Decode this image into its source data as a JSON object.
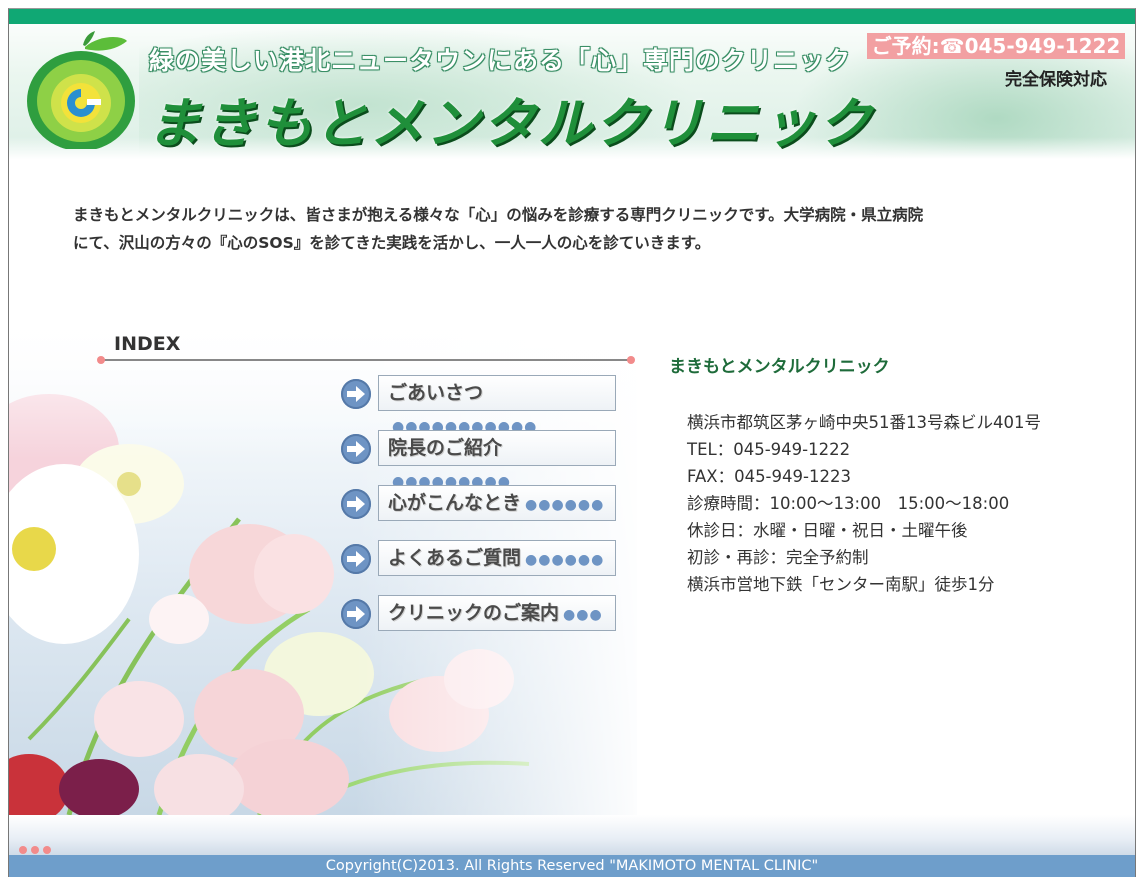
{
  "header": {
    "tagline": "緑の美しい港北ニュータウンにある「心」専門のクリニック",
    "title": "まきもとメンタルクリニック",
    "phone": "ご予約:☎045-949-1222",
    "insurance": "完全保険対応"
  },
  "intro": {
    "line1": "まきもとメンタルクリニックは、皆さまが抱える様々な「心」の悩みを診療する専門クリニックです。大学病院・県立病院",
    "line2": "にて、沢山の方々の『心のSOS』を診てきた実践を活かし、一人一人の心を診ていきます。"
  },
  "index": {
    "heading": "INDEX",
    "items": [
      {
        "label": "ごあいさつ",
        "dots": "●●●●●●●●●●●"
      },
      {
        "label": "院長のご紹介",
        "dots": "●●●●●●●●●"
      },
      {
        "label": "心がこんなとき",
        "dots": "●●●●●●"
      },
      {
        "label": "よくあるご質問",
        "dots": "●●●●●●"
      },
      {
        "label": "クリニックのご案内",
        "dots": "●●●"
      }
    ]
  },
  "clinic_info": {
    "name": "まきもとメンタルクリニック",
    "address": "横浜市都筑区茅ヶ崎中央51番13号森ビル401号",
    "tel": "TEL：045-949-1222",
    "fax": "FAX：045-949-1223",
    "hours": "診療時間：10:00〜13:00　15:00〜18:00",
    "closed": "休診日：水曜・日曜・祝日・土曜午後",
    "appointment": "初診・再診：完全予約制",
    "access": "横浜市営地下鉄「センター南駅」徒歩1分"
  },
  "footer": {
    "copyright": "Copyright(C)2013. All Rights Reserved \"MAKIMOTO MENTAL CLINIC\""
  },
  "colors": {
    "brand_green": "#10a874",
    "title_green": "#1f8f3a",
    "phone_pink": "#f2a0a2",
    "footer_blue": "#6e9ecb",
    "arrow_blue": "#6e94c4",
    "info_title_green": "#1e6b3a"
  },
  "icons": {
    "logo": "apple-logo-icon",
    "menu_arrow": "arrow-right-circle-icon"
  }
}
